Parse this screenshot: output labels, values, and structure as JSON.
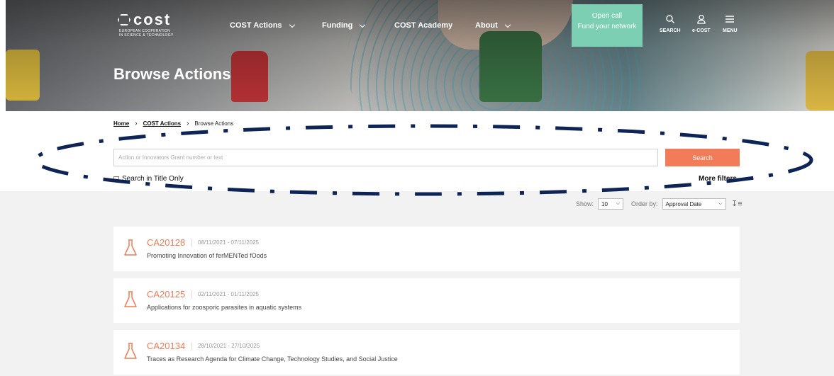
{
  "header": {
    "logo_word": "cost",
    "logo_sub_1": "EUROPEAN COOPERATION",
    "logo_sub_2": "IN SCIENCE & TECHNOLOGY",
    "nav": [
      {
        "label": "COST Actions",
        "dropdown": true
      },
      {
        "label": "Funding",
        "dropdown": true
      },
      {
        "label": "COST Academy",
        "dropdown": false
      },
      {
        "label": "About",
        "dropdown": true
      }
    ],
    "open_call": {
      "line1": "Open call",
      "line2": "Fund your network"
    },
    "icons": [
      {
        "name": "search-icon",
        "label": "SEARCH"
      },
      {
        "name": "user-icon",
        "label": "e-COST"
      },
      {
        "name": "menu-icon",
        "label": "MENU"
      }
    ],
    "page_title": "Browse Actions"
  },
  "breadcrumb": {
    "home": "Home",
    "section": "COST Actions",
    "current": "Browse Actions"
  },
  "search": {
    "placeholder": "Action or Innovators Grant number or text",
    "button": "Search",
    "title_only_label": "Search in Title Only",
    "more_filters": "More filters"
  },
  "sort": {
    "show_label": "Show:",
    "show_value": "10",
    "order_label": "Order by:",
    "order_value": "Approval Date"
  },
  "actions": [
    {
      "code": "CA20128",
      "dates": "08/11/2021 - 07/11/2025",
      "title": "Promoting Innovation of ferMENTed fOods"
    },
    {
      "code": "CA20125",
      "dates": "02/11/2021 - 01/11/2025",
      "title": "Applications for zoosporic parasites in aquatic systems"
    },
    {
      "code": "CA20134",
      "dates": "28/10/2021 - 27/10/2025",
      "title": "Traces as Research Agenda for Climate Change, Technology Studies, and Social Justice"
    }
  ],
  "colors": {
    "accent": "#f27c58",
    "open_call": "#7ccfb3",
    "annotation": "#0e2457"
  }
}
